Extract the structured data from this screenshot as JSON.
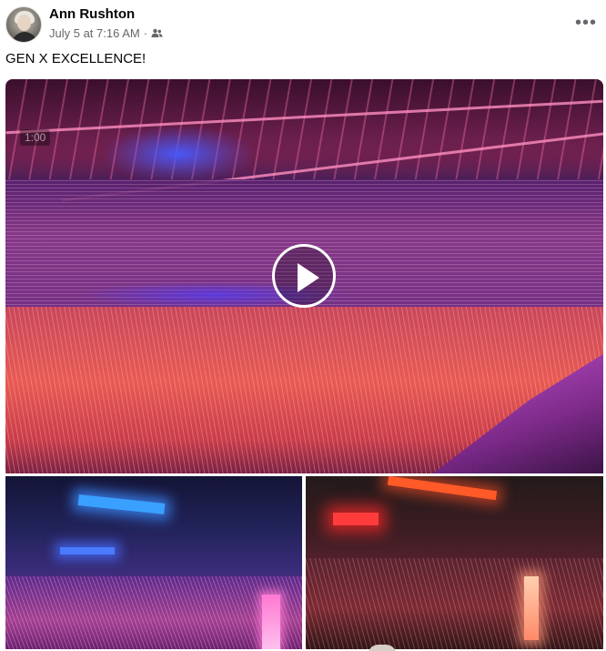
{
  "post": {
    "author": "Ann Rushton",
    "timestamp": "July 5 at 7:16 AM",
    "separator": "·",
    "audience_icon": "friends-icon",
    "more_icon": "more-horizontal-icon",
    "text": "GEN X EXCELLENCE!"
  },
  "media": {
    "video": {
      "duration": "1:00",
      "play_icon": "play-icon"
    },
    "photos": [
      {
        "id": "left"
      },
      {
        "id": "right"
      }
    ]
  },
  "colors": {
    "text_primary": "#050505",
    "text_secondary": "#65676b",
    "background": "#ffffff"
  }
}
